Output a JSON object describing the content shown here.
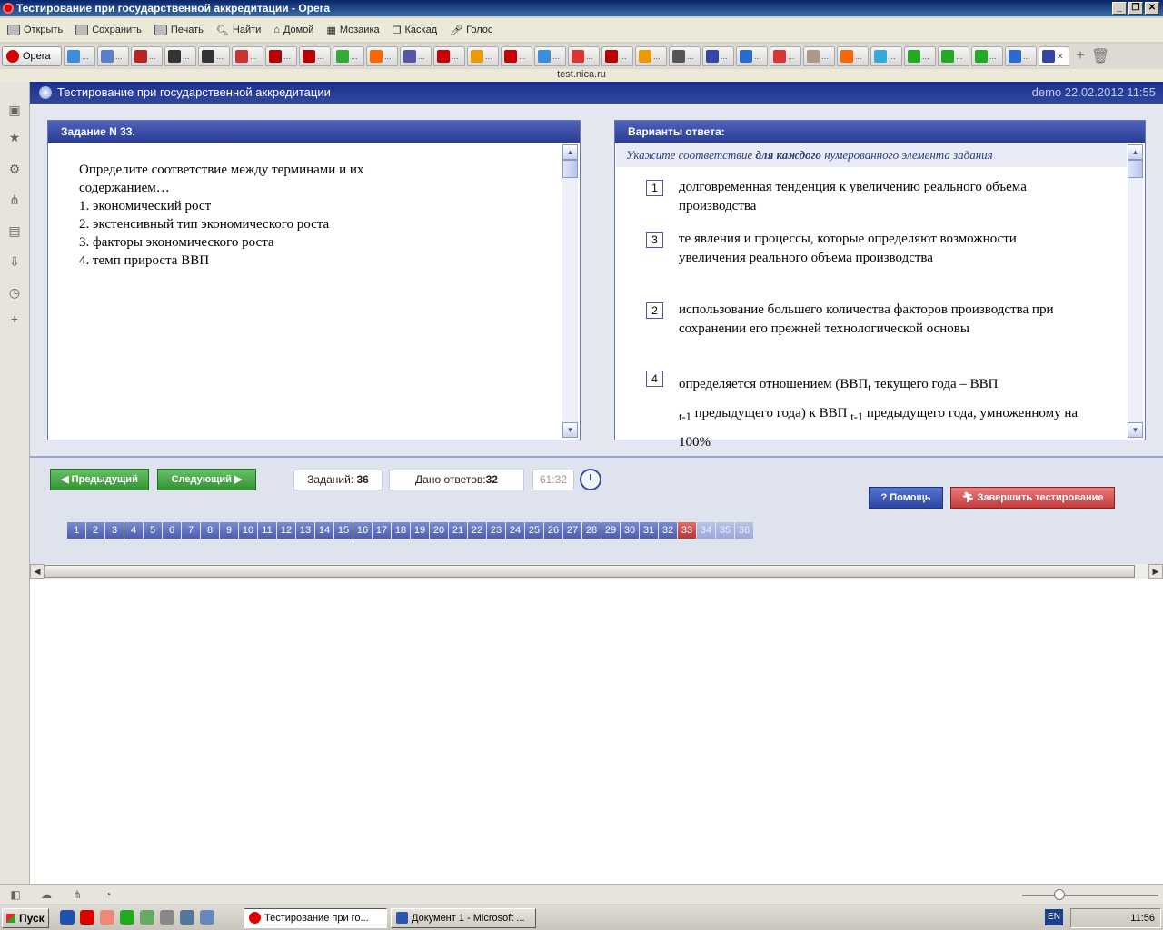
{
  "window": {
    "title": "Тестирование при государственной аккредитации - Opera"
  },
  "toolbar": {
    "open": "Открыть",
    "save": "Сохранить",
    "print": "Печать",
    "find": "Найти",
    "home": "Домой",
    "mosaic": "Мозаика",
    "cascade": "Каскад",
    "voice": "Голос"
  },
  "tabbar": {
    "menu_label": "Opera"
  },
  "address": "test.nica.ru",
  "app": {
    "title": "Тестирование при государственной аккредитации",
    "user_info": "demo 22.02.2012 11:55"
  },
  "question": {
    "header": "Задание N 33.",
    "lines": [
      "Определите соответствие между терминами и их",
      "содержанием…",
      "1. экономический рост",
      "2. экстенсивный тип экономического роста",
      "3. факторы экономического роста",
      "4. темп прироста ВВП"
    ]
  },
  "answers": {
    "header": "Варианты ответа:",
    "instruction_pre": "Укажите соответствие ",
    "instruction_bold": "для каждого",
    "instruction_post": " нумерованного элемента задания",
    "items": [
      {
        "num": "1",
        "text": "долговременная тенденция к увеличению реального объема производства"
      },
      {
        "num": "3",
        "text": "те явления и процессы, которые определяют возможности увеличения реального объема производства"
      },
      {
        "num": "2",
        "text": "использование большего количества факторов производства при сохранении его прежней технологической основы"
      },
      {
        "num": "4",
        "text_a": "определяется отношением (ВВП",
        "sub1": "t",
        "text_b": " текущего года – ВВП",
        "sub2": "t-1",
        "text_c": " предыдущего года) к ВВП ",
        "sub3": "t-1",
        "text_d": " предыдущего года, умноженному на 100%"
      }
    ]
  },
  "nav": {
    "prev": "Предыдущий",
    "next": "Следующий",
    "tasks_label": "Заданий: ",
    "tasks_value": "36",
    "answered_label": "Дано ответов:",
    "answered_value": "32",
    "timer": "61:32",
    "help": "Помощь",
    "finish": "Завершить тестирование",
    "pages": [
      "1",
      "2",
      "3",
      "4",
      "5",
      "6",
      "7",
      "8",
      "9",
      "10",
      "11",
      "12",
      "13",
      "14",
      "15",
      "16",
      "17",
      "18",
      "19",
      "20",
      "21",
      "22",
      "23",
      "24",
      "25",
      "26",
      "27",
      "28",
      "29",
      "30",
      "31",
      "32",
      "33",
      "34",
      "35",
      "36"
    ],
    "current_page": "33"
  },
  "taskbar": {
    "start": "Пуск",
    "task1": "Тестирование при го...",
    "task2": "Документ 1 - Microsoft ...",
    "lang": "EN",
    "clock": "11:56"
  }
}
